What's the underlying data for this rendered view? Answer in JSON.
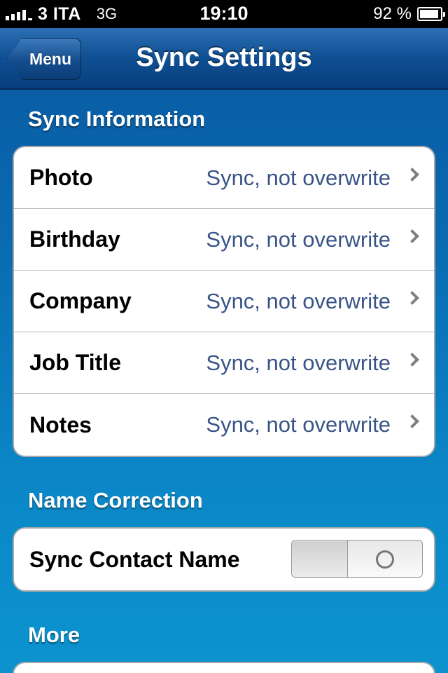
{
  "status_bar": {
    "carrier": "3 ITA",
    "network": "3G",
    "time": "19:10",
    "battery_percent": "92 %",
    "battery_level": 0.92
  },
  "nav": {
    "back_label": "Menu",
    "title": "Sync Settings"
  },
  "sections": {
    "sync_info": {
      "header": "Sync Information",
      "rows": [
        {
          "label": "Photo",
          "value": "Sync, not overwrite"
        },
        {
          "label": "Birthday",
          "value": "Sync, not overwrite"
        },
        {
          "label": "Company",
          "value": "Sync, not overwrite"
        },
        {
          "label": "Job Title",
          "value": "Sync, not overwrite"
        },
        {
          "label": "Notes",
          "value": "Sync, not overwrite"
        }
      ]
    },
    "name_correction": {
      "header": "Name Correction",
      "rows": [
        {
          "label": "Sync Contact Name",
          "toggle_on": false
        }
      ]
    },
    "more": {
      "header": "More"
    }
  },
  "colors": {
    "value_text": "#385487",
    "nav_bar": "#0f4f93"
  }
}
